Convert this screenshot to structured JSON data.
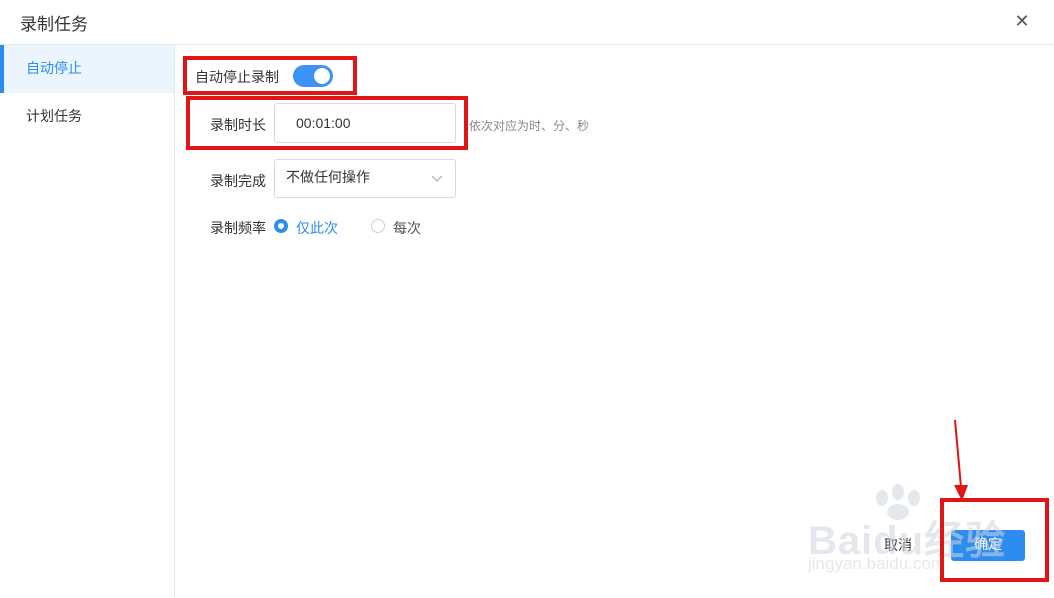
{
  "dialog": {
    "title": "录制任务",
    "close_icon": "close-icon"
  },
  "sidebar": {
    "items": [
      {
        "label": "自动停止",
        "active": true
      },
      {
        "label": "计划任务",
        "active": false
      }
    ]
  },
  "form": {
    "auto_stop_label": "自动停止录制",
    "auto_stop_enabled": true,
    "duration_label": "录制时长",
    "duration_value": "00:01:00",
    "duration_hint": "依次对应为时、分、秒",
    "on_complete_label": "录制完成",
    "on_complete_value": "不做任何操作",
    "frequency_label": "录制频率",
    "frequency_options": [
      {
        "label": "仅此次",
        "selected": true
      },
      {
        "label": "每次",
        "selected": false
      }
    ]
  },
  "footer": {
    "cancel_label": "取消",
    "ok_label": "确定"
  },
  "watermark": {
    "main": "Baidu经验",
    "sub": "jingyan.baidu.com"
  },
  "colors": {
    "accent": "#2d8cf0",
    "annotation": "#e01515",
    "toggle_on": "#3d92f5"
  }
}
